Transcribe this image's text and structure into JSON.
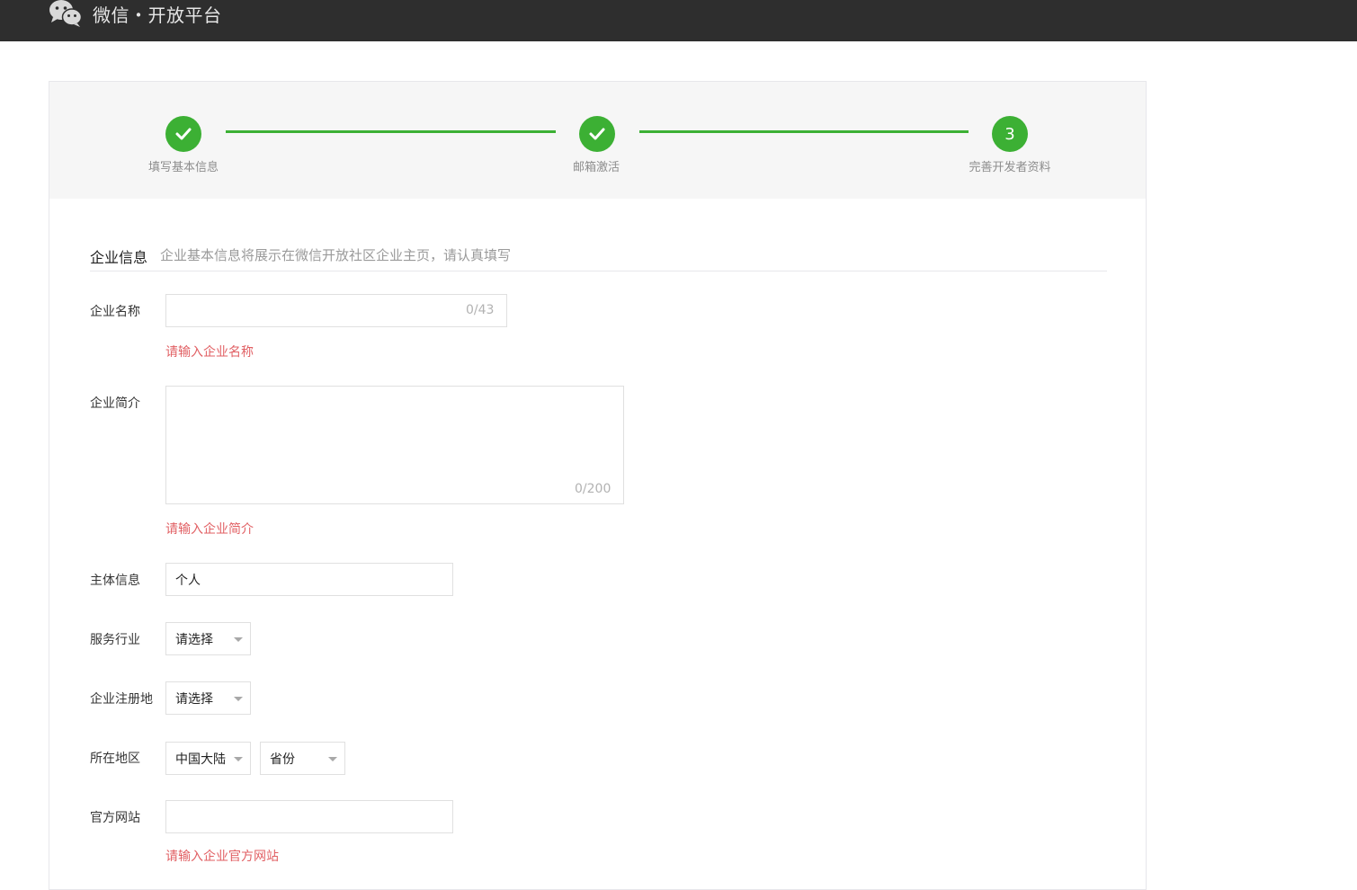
{
  "header": {
    "brand": "微信・开放平台"
  },
  "steps": [
    {
      "label": "填写基本信息",
      "status": "done"
    },
    {
      "label": "邮箱激活",
      "status": "done"
    },
    {
      "label": "完善开发者资料",
      "status": "current",
      "number": "3"
    }
  ],
  "section": {
    "title": "企业信息",
    "desc": "企业基本信息将展示在微信开放社区企业主页，请认真填写"
  },
  "form": {
    "company_name": {
      "label": "企业名称",
      "value": "",
      "counter": "0/43",
      "error": "请输入企业名称"
    },
    "company_intro": {
      "label": "企业简介",
      "value": "",
      "counter": "0/200",
      "error": "请输入企业简介"
    },
    "entity": {
      "label": "主体信息",
      "value": "个人"
    },
    "industry": {
      "label": "服务行业",
      "selected": "请选择"
    },
    "reg_place": {
      "label": "企业注册地",
      "selected": "请选择"
    },
    "region": {
      "label": "所在地区",
      "country": "中国大陆",
      "province": "省份"
    },
    "website": {
      "label": "官方网站",
      "value": "",
      "error": "请输入企业官方网站"
    }
  },
  "colors": {
    "accent": "#3cb034",
    "error": "#e15f63",
    "topbar": "#2e2e2e"
  }
}
